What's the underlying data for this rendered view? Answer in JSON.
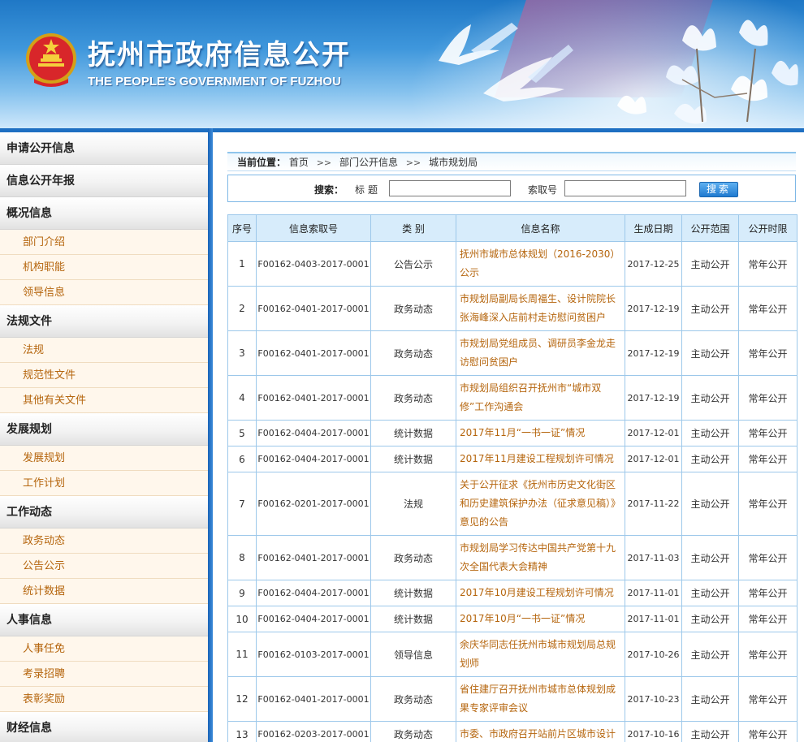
{
  "header": {
    "title": "抚州市政府信息公开",
    "subtitle": "THE PEOPLE'S GOVERNMENT OF FUZHOU",
    "colors": {
      "banner_top": "#1f78c6",
      "accent": "#1e6fc2",
      "link": "#b5650d"
    }
  },
  "sidebar": {
    "groups": [
      {
        "label": "申请公开信息",
        "items": []
      },
      {
        "label": "信息公开年报",
        "items": []
      },
      {
        "label": "概况信息",
        "items": [
          "部门介绍",
          "机构职能",
          "领导信息"
        ]
      },
      {
        "label": "法规文件",
        "items": [
          "法规",
          "规范性文件",
          "其他有关文件"
        ]
      },
      {
        "label": "发展规划",
        "items": [
          "发展规划",
          "工作计划"
        ]
      },
      {
        "label": "工作动态",
        "items": [
          "政务动态",
          "公告公示",
          "统计数据"
        ]
      },
      {
        "label": "人事信息",
        "items": [
          "人事任免",
          "考录招聘",
          "表彰奖励"
        ]
      },
      {
        "label": "财经信息",
        "items": []
      }
    ]
  },
  "breadcrumb": {
    "label": "当前位置：",
    "items": [
      "首页",
      "部门公开信息",
      "城市规划局"
    ],
    "separator": ">>"
  },
  "search": {
    "title": "搜索：",
    "field1_label": "标题",
    "field1_value": "",
    "field2_label": "索取号",
    "field2_value": "",
    "button_label": "搜索"
  },
  "table": {
    "headers": [
      "序号",
      "信息索取号",
      "类 别",
      "信息名称",
      "生成日期",
      "公开范围",
      "公开时限"
    ],
    "rows": [
      [
        "1",
        "F00162-0403-2017-0001",
        "公告公示",
        "抚州市城市总体规划（2016-2030）公示",
        "2017-12-25",
        "主动公开",
        "常年公开"
      ],
      [
        "2",
        "F00162-0401-2017-0001",
        "政务动态",
        "市规划局副局长周福生、设计院院长张海峰深入店前村走访慰问贫困户",
        "2017-12-19",
        "主动公开",
        "常年公开"
      ],
      [
        "3",
        "F00162-0401-2017-0001",
        "政务动态",
        "市规划局党组成员、调研员李金龙走访慰问贫困户",
        "2017-12-19",
        "主动公开",
        "常年公开"
      ],
      [
        "4",
        "F00162-0401-2017-0001",
        "政务动态",
        "市规划局组织召开抚州市“城市双修”工作沟通会",
        "2017-12-19",
        "主动公开",
        "常年公开"
      ],
      [
        "5",
        "F00162-0404-2017-0001",
        "统计数据",
        "2017年11月“一书一证”情况",
        "2017-12-01",
        "主动公开",
        "常年公开"
      ],
      [
        "6",
        "F00162-0404-2017-0001",
        "统计数据",
        "2017年11月建设工程规划许可情况",
        "2017-12-01",
        "主动公开",
        "常年公开"
      ],
      [
        "7",
        "F00162-0201-2017-0001",
        "法规",
        "关于公开征求《抚州市历史文化街区和历史建筑保护办法（征求意见稿）》意见的公告",
        "2017-11-22",
        "主动公开",
        "常年公开"
      ],
      [
        "8",
        "F00162-0401-2017-0001",
        "政务动态",
        "市规划局学习传达中国共产党第十九次全国代表大会精神",
        "2017-11-03",
        "主动公开",
        "常年公开"
      ],
      [
        "9",
        "F00162-0404-2017-0001",
        "统计数据",
        "2017年10月建设工程规划许可情况",
        "2017-11-01",
        "主动公开",
        "常年公开"
      ],
      [
        "10",
        "F00162-0404-2017-0001",
        "统计数据",
        "2017年10月“一书一证”情况",
        "2017-11-01",
        "主动公开",
        "常年公开"
      ],
      [
        "11",
        "F00162-0103-2017-0001",
        "领导信息",
        "余庆华同志任抚州市城市规划局总规划师",
        "2017-10-26",
        "主动公开",
        "常年公开"
      ],
      [
        "12",
        "F00162-0401-2017-0001",
        "政务动态",
        "省住建厅召开抚州市城市总体规划成果专家评审会议",
        "2017-10-23",
        "主动公开",
        "常年公开"
      ],
      [
        "13",
        "F00162-0203-2017-0001",
        "政务动态",
        "市委、市政府召开站前片区城市设计",
        "2017-10-16",
        "主动公开",
        "常年公开"
      ]
    ]
  }
}
